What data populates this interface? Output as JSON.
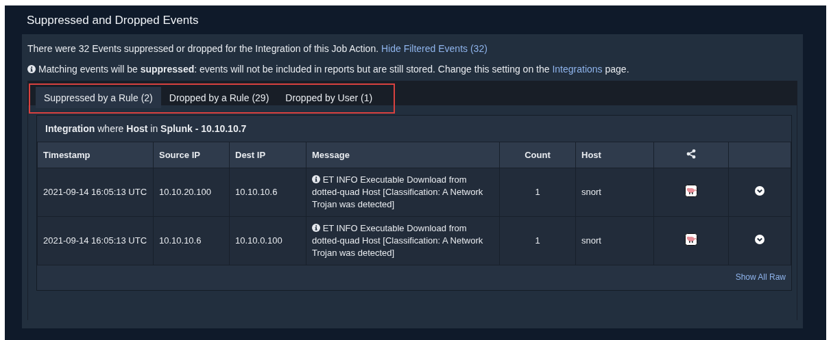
{
  "title": "Suppressed and Dropped Events",
  "summary": {
    "text": "There were 32 Events suppressed or dropped for the Integration of this Job Action.",
    "link": "Hide Filtered Events (32)"
  },
  "notice": {
    "text": "Matching events will be  **suppressed**: events will not be included in reports but are still stored. Change this setting on the",
    "link": "Integrations",
    "after": "page."
  },
  "tabs": [
    {
      "label": "Suppressed by a Rule (2)",
      "selected": true
    },
    {
      "label": "Dropped by a Rule (29)",
      "selected": false
    },
    {
      "label": "Dropped by User (1)",
      "selected": false
    }
  ],
  "table": {
    "caption": "**Integration** where **Host** in **Splunk - 10.10.10.7**",
    "columns": [
      {
        "label": "Timestamp",
        "kind": "text"
      },
      {
        "label": "Source IP",
        "kind": "text"
      },
      {
        "label": "Dest IP",
        "kind": "text"
      },
      {
        "label": "Message",
        "kind": "text"
      },
      {
        "label": "Count",
        "kind": "center"
      },
      {
        "label": "Host",
        "kind": "text"
      },
      {
        "kind": "share"
      },
      {
        "kind": "blank"
      }
    ],
    "rows": [
      {
        "timestamp": "2021-09-14 16:05:13 UTC",
        "source_ip": "10.10.20.100",
        "dest_ip": "10.10.10.6",
        "message": "ET INFO Executable Download from dotted-quad Host [Classification: A Network Trojan was detected]",
        "count": "1",
        "host": "snort"
      },
      {
        "timestamp": "2021-09-14 16:05:13 UTC",
        "source_ip": "10.10.10.6",
        "dest_ip": "10.10.0.100",
        "message": "ET INFO Executable Download from dotted-quad Host [Classification: A Network Trojan was detected]",
        "count": "1",
        "host": "snort"
      }
    ],
    "footer_link": "Show All Raw"
  }
}
